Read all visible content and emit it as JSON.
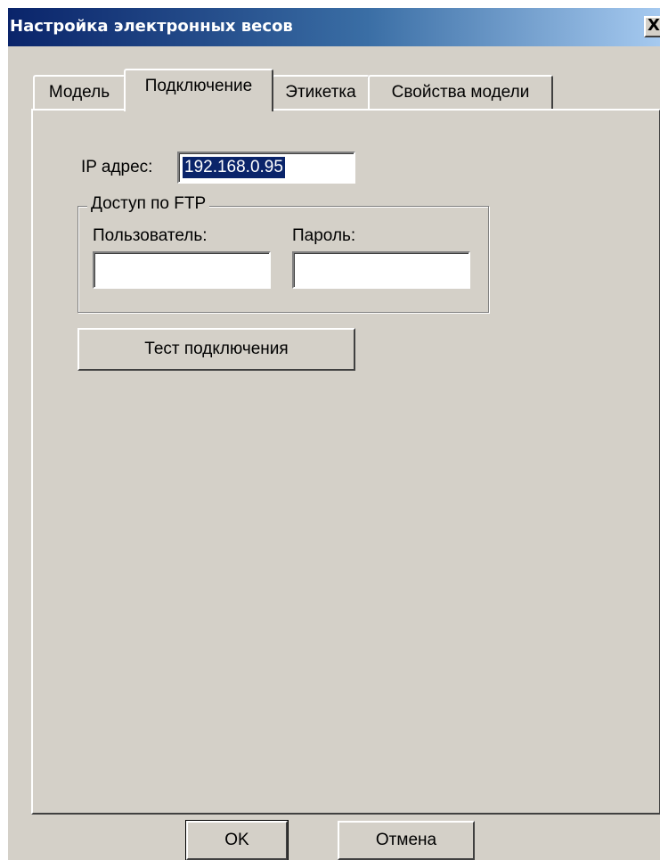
{
  "window": {
    "title": "Настройка электронных весов",
    "close_glyph": "X"
  },
  "tabs": [
    {
      "label": "Модель",
      "active": false
    },
    {
      "label": "Подключение",
      "active": true
    },
    {
      "label": "Этикетка",
      "active": false
    },
    {
      "label": "Свойства модели",
      "active": false
    }
  ],
  "connection": {
    "ip_label": "IP адрес:",
    "ip_value": "192.168.0.95",
    "ftp_group_label": "Доступ по FTP",
    "user_label": "Пользователь:",
    "user_value": "",
    "password_label": "Пароль:",
    "password_value": "",
    "test_button_label": "Тест подключения"
  },
  "footer": {
    "ok_label": "OK",
    "cancel_label": "Отмена"
  },
  "colors": {
    "face": "#d4d0c8",
    "title_start": "#0a246a",
    "title_end": "#a6caf0",
    "selection": "#0a246a"
  }
}
